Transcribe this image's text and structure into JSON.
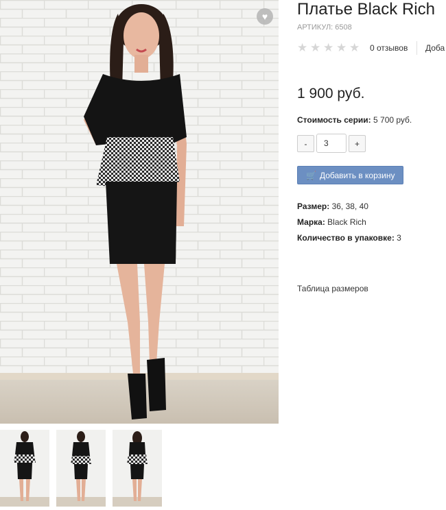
{
  "product": {
    "title": "Платье Black Rich",
    "sku_label": "Артикул:",
    "sku_value": "6508",
    "rating_stars": 0,
    "reviews_text": "0 отзывов",
    "add_review_text": "Доба",
    "price": "1 900 руб.",
    "series_label": "Стоимость серии:",
    "series_value": "5 700 руб.",
    "qty_minus": "-",
    "qty_value": "3",
    "qty_plus": "+",
    "cart_button": "Добавить в корзину",
    "specs": [
      {
        "label": "Размер:",
        "value": "36, 38, 40"
      },
      {
        "label": "Марка:",
        "value": "Black Rich"
      },
      {
        "label": "Количество в упаковке:",
        "value": "3"
      }
    ],
    "size_table_link": "Таблица размеров"
  },
  "icons": {
    "wishlist": "heart-icon",
    "cart": "cart-icon",
    "star": "star-icon"
  },
  "colors": {
    "cart_button": "#6c8fc2",
    "star_empty": "#d6d6d6",
    "sku": "#999999"
  }
}
